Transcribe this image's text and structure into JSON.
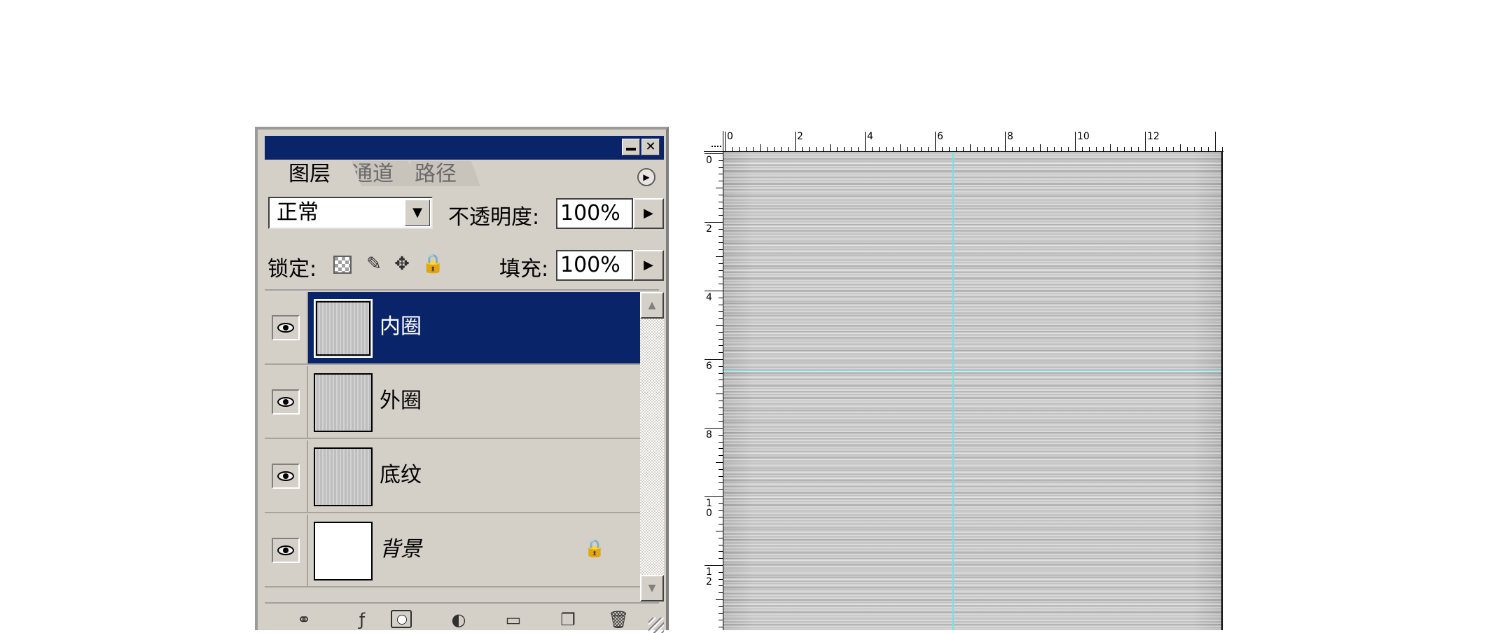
{
  "layers_panel": {
    "tabs": [
      {
        "label": "图层",
        "active": true
      },
      {
        "label": "通道",
        "active": false
      },
      {
        "label": "路径",
        "active": false
      }
    ],
    "menu_icon": "play-circle-icon",
    "blend_mode": "正常",
    "opacity_label": "不透明度:",
    "opacity_value": "100%",
    "lock_label": "锁定:",
    "fill_label": "填充:",
    "fill_value": "100%",
    "lock_icons": {
      "transparent": "",
      "brush": "✎",
      "move": "✥",
      "all": "🔒"
    },
    "layers": [
      {
        "name": "内圈",
        "visible": true,
        "selected": true,
        "thumbnail": "texture"
      },
      {
        "name": "外圈",
        "visible": true,
        "selected": false,
        "thumbnail": "texture"
      },
      {
        "name": "底纹",
        "visible": true,
        "selected": false,
        "thumbnail": "texture"
      },
      {
        "name": "背景",
        "visible": true,
        "selected": false,
        "thumbnail": "white",
        "locked": true
      }
    ],
    "bottom_icons": {
      "link": "⚭",
      "layer_style": "ƒ",
      "mask": "",
      "adjustment": "◐",
      "new_group": "▭",
      "new_layer": "❐",
      "delete": "🗑"
    }
  },
  "document": {
    "ruler_top_labels": [
      "0",
      "2",
      "4",
      "6",
      "8",
      "10",
      "12"
    ],
    "ruler_left_labels": [
      "0",
      "2",
      "4",
      "6",
      "8",
      "1\n0",
      "1\n2"
    ],
    "guide_color": "#7fdede"
  }
}
